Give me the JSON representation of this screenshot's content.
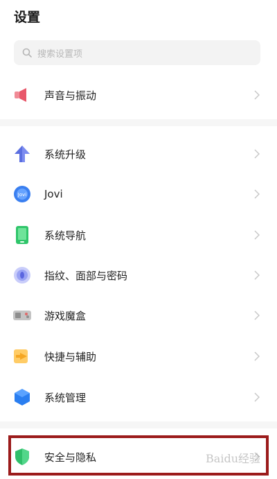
{
  "header": {
    "title": "设置"
  },
  "search": {
    "placeholder": "搜索设置项"
  },
  "items": [
    {
      "label": "声音与振动",
      "icon": "speaker-icon",
      "color": "#e8576a"
    },
    {
      "label": "系统升级",
      "icon": "upgrade-arrow-icon",
      "color": "#5b6fe0"
    },
    {
      "label": "Jovi",
      "icon": "jovi-icon",
      "color": "#3a7ff0"
    },
    {
      "label": "系统导航",
      "icon": "phone-nav-icon",
      "color": "#2fc56a"
    },
    {
      "label": "指纹、面部与密码",
      "icon": "fingerprint-icon",
      "color": "#7b86f0"
    },
    {
      "label": "游戏魔盒",
      "icon": "game-box-icon",
      "color": "#9a9a9a"
    },
    {
      "label": "快捷与辅助",
      "icon": "shortcut-icon",
      "color": "#f5a623"
    },
    {
      "label": "系统管理",
      "icon": "system-manage-icon",
      "color": "#2a7ef0"
    },
    {
      "label": "安全与隐私",
      "icon": "shield-icon",
      "color": "#2fbf6a"
    }
  ],
  "watermark": "Baidu经验"
}
